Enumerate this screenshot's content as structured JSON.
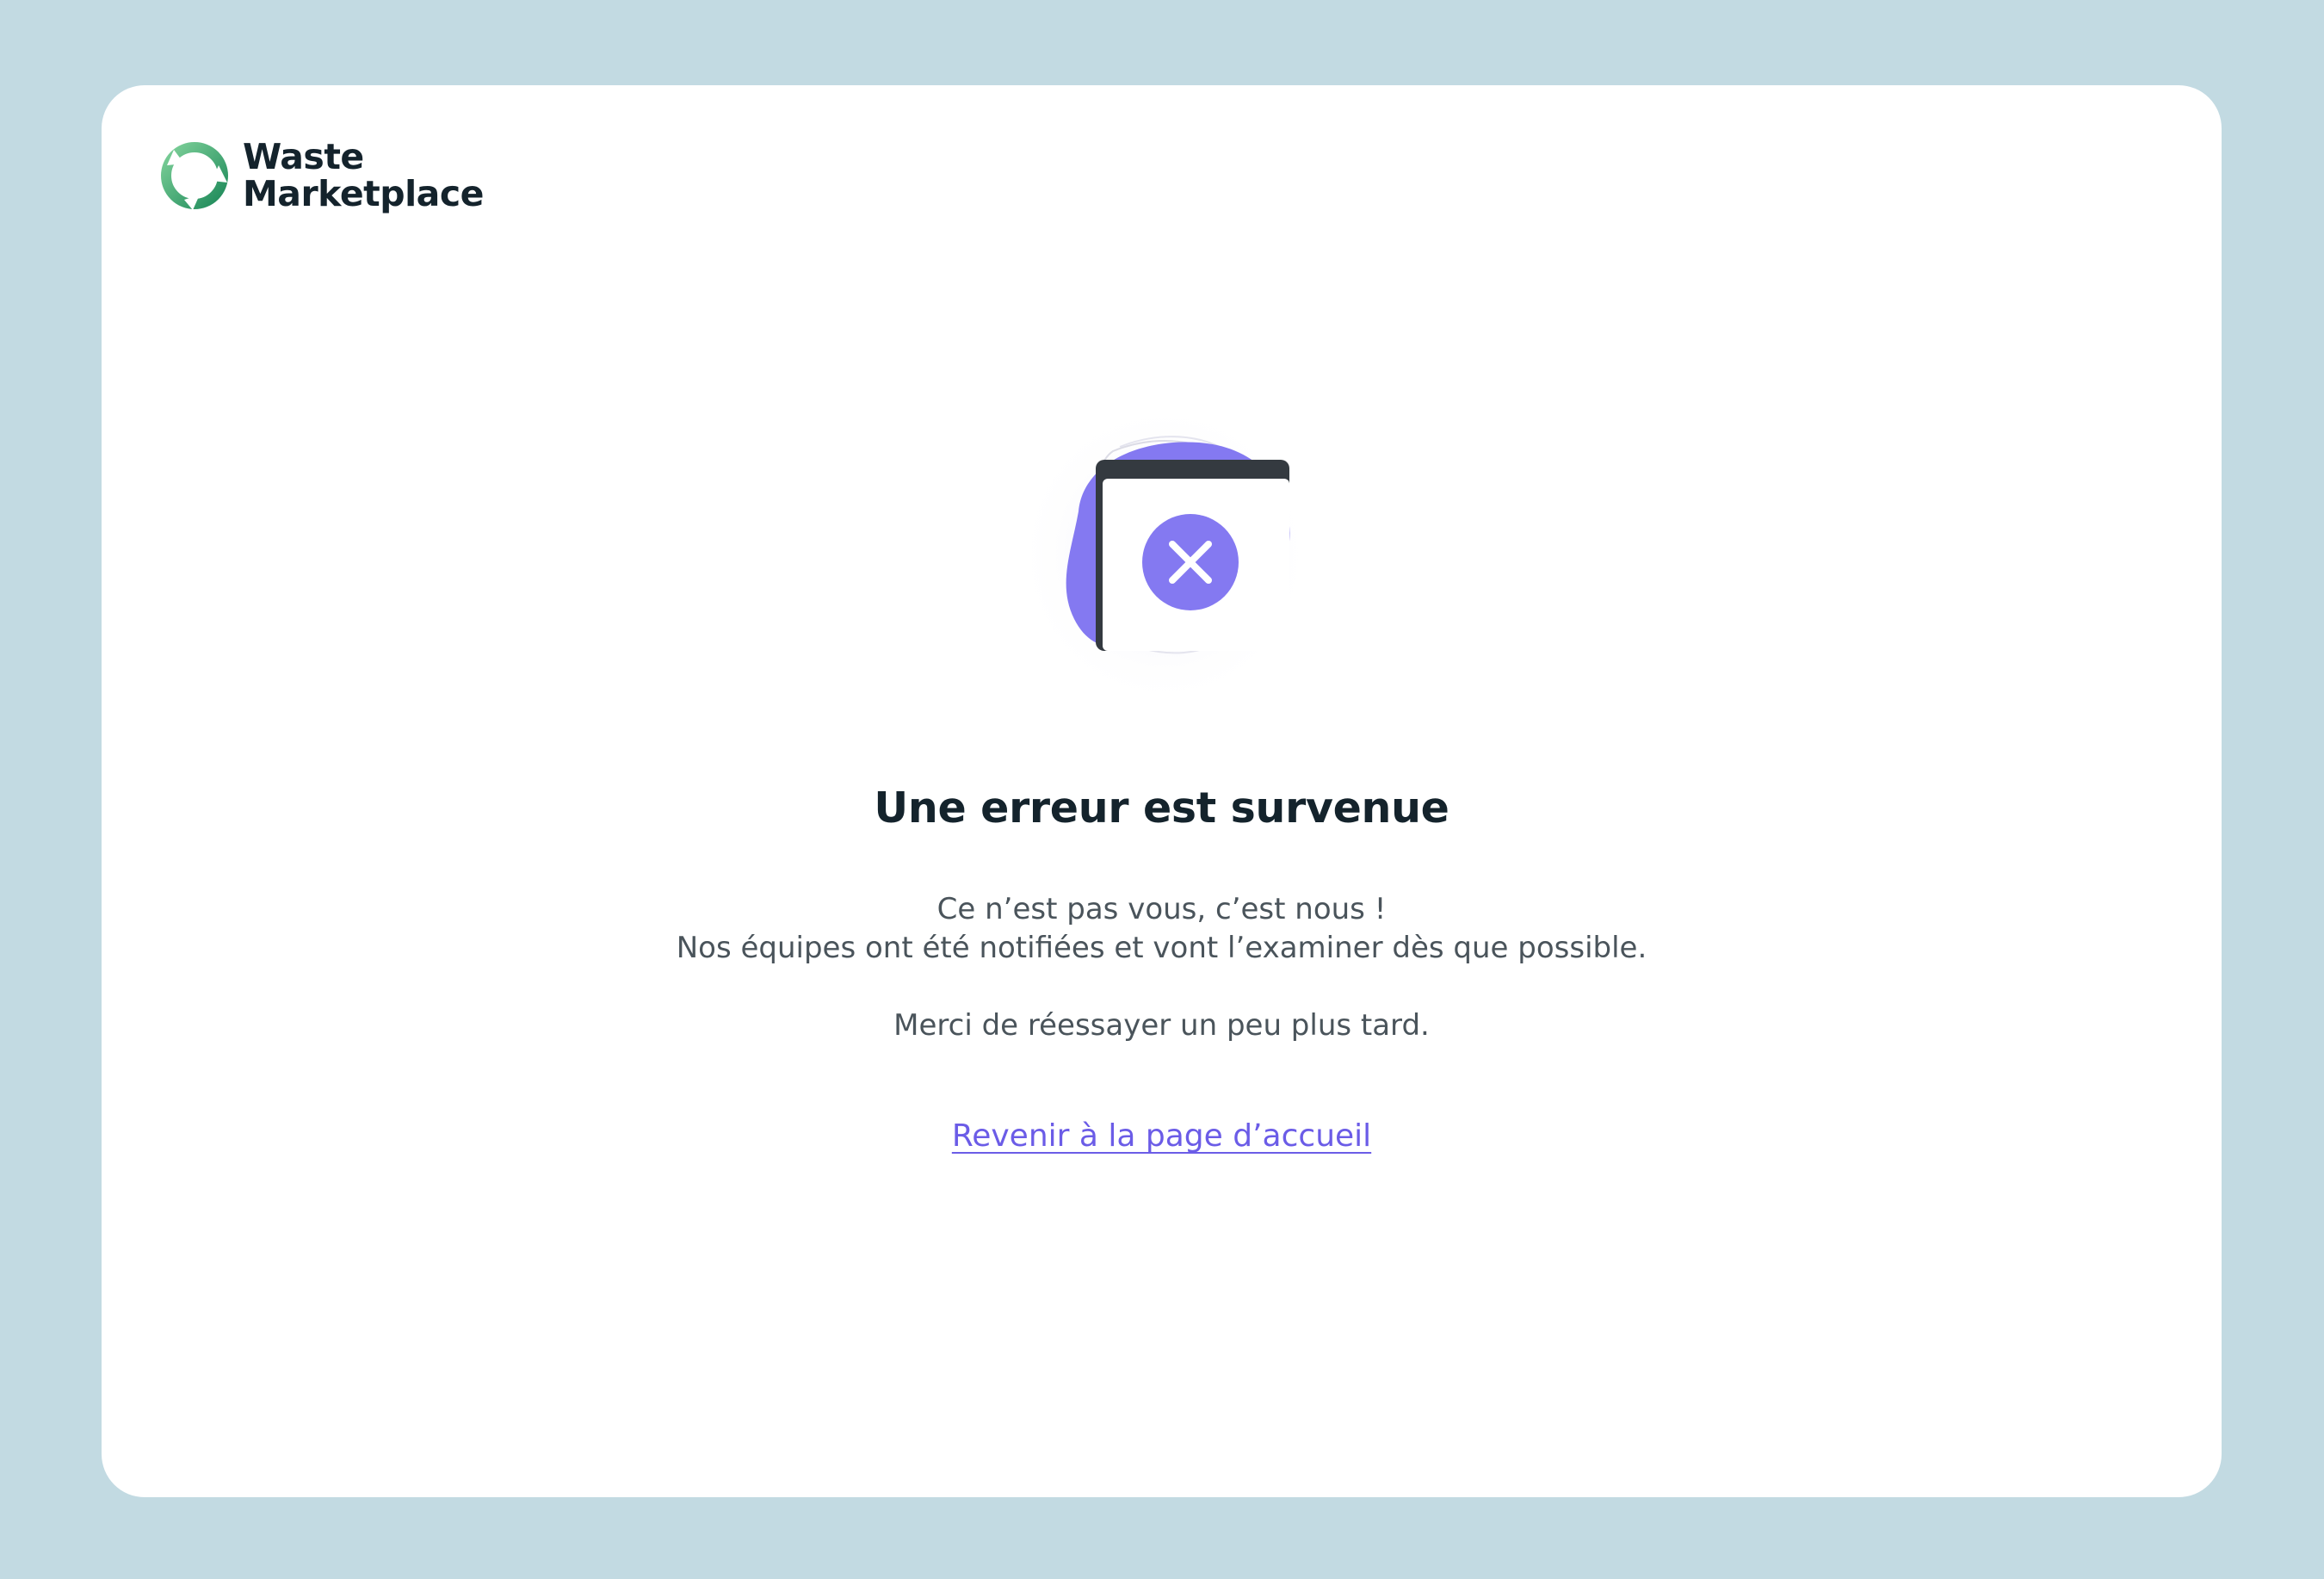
{
  "brand": {
    "name_line1": "Waste",
    "name_line2": "Marketplace",
    "logo_icon": "recycle-ring-icon",
    "colors": {
      "logo_green_light": "#6cc28a",
      "logo_green_dark": "#1e8a5a",
      "text": "#14232c"
    }
  },
  "error": {
    "illustration_icon": "browser-window-error-icon",
    "close_icon": "x-circle-icon",
    "title": "Une erreur est survenue",
    "line1": "Ce n’est pas vous, c’est nous !",
    "line2": "Nos équipes ont été notifiées et vont l’examiner dès que possible.",
    "line3": "Merci de réessayer un peu plus tard."
  },
  "actions": {
    "home_link": "Revenir à la page d’accueil"
  },
  "colors": {
    "page_background": "#c2dae2",
    "card_background": "#ffffff",
    "accent": "#7f73f0",
    "link": "#6b5ce7",
    "body_text": "#4a545b"
  }
}
